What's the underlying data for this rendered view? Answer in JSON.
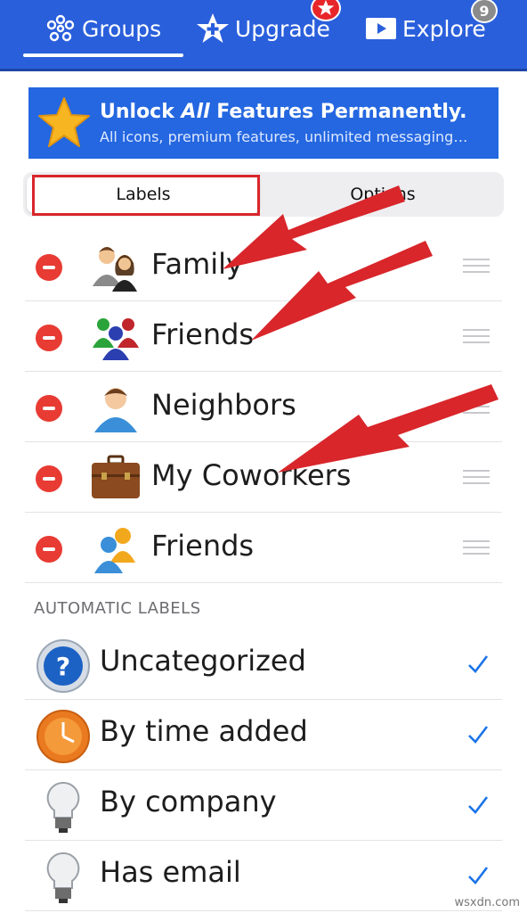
{
  "nav": {
    "groups": "Groups",
    "upgrade": "Upgrade",
    "explore": "Explore",
    "explore_badge": "9"
  },
  "banner": {
    "title_prefix": "Unlock ",
    "title_em": "All",
    "title_suffix": " Features Permanently.",
    "subtitle": "All icons, premium features, unlimited messaging…"
  },
  "segmented": {
    "labels": "Labels",
    "options": "Options"
  },
  "labels": [
    {
      "name": "Family",
      "icon": "family-icon"
    },
    {
      "name": "Friends",
      "icon": "friends-group-icon"
    },
    {
      "name": "Neighbors",
      "icon": "person-icon"
    },
    {
      "name": "My Coworkers",
      "icon": "briefcase-icon"
    },
    {
      "name": "Friends",
      "icon": "friends-pair-icon"
    }
  ],
  "automatic": {
    "header": "AUTOMATIC LABELS",
    "items": [
      {
        "name": "Uncategorized",
        "icon": "question-icon",
        "checked": true
      },
      {
        "name": "By time added",
        "icon": "clock-icon",
        "checked": true
      },
      {
        "name": "By company",
        "icon": "lightbulb-icon",
        "checked": true
      },
      {
        "name": "Has email",
        "icon": "lightbulb-icon",
        "checked": true
      }
    ]
  },
  "watermark": "wsxdn.com",
  "colors": {
    "nav_bg": "#2a5fdc",
    "banner_bg": "#2467e0",
    "delete_red": "#e83b33",
    "check_blue": "#1a73e8",
    "annotation_red": "#d8262b"
  }
}
